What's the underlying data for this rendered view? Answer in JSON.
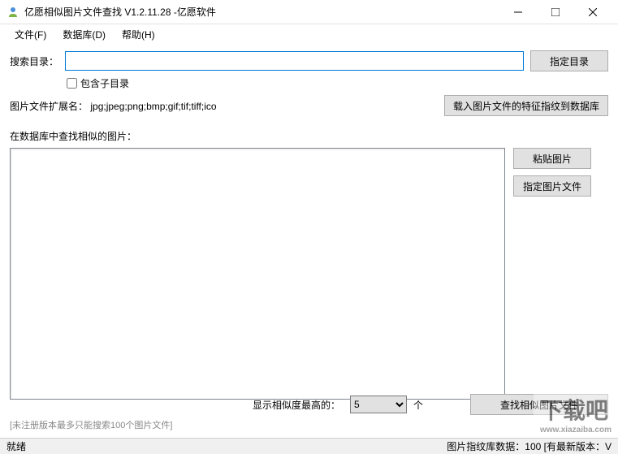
{
  "window": {
    "title": "亿愿相似图片文件查找 V1.2.11.28 -亿愿软件"
  },
  "menubar": {
    "file": "文件(F)",
    "database": "数据库(D)",
    "help": "帮助(H)"
  },
  "search": {
    "label": "搜索目录：",
    "value": "",
    "browse_btn": "指定目录",
    "include_sub": "包含子目录",
    "ext_label": "图片文件扩展名：",
    "ext_value": "jpg;jpeg;png;bmp;gif;tif;tiff;ico",
    "load_btn": "载入图片文件的特征指纹到数据库"
  },
  "similar": {
    "section_label": "在数据库中查找相似的图片：",
    "paste_btn": "粘贴图片",
    "file_btn": "指定图片文件",
    "similarity_label": "显示相似度最高的：",
    "similarity_value": "5",
    "unit": "个",
    "search_btn": "查找相似图片文件"
  },
  "note": "[未注册版本最多只能搜索100个图片文件]",
  "statusbar": {
    "left": "就绪",
    "right": "图片指纹库数据：100  [有最新版本：V"
  },
  "watermark": {
    "main": "下载吧",
    "sub": "www.xiazaiba.com"
  }
}
